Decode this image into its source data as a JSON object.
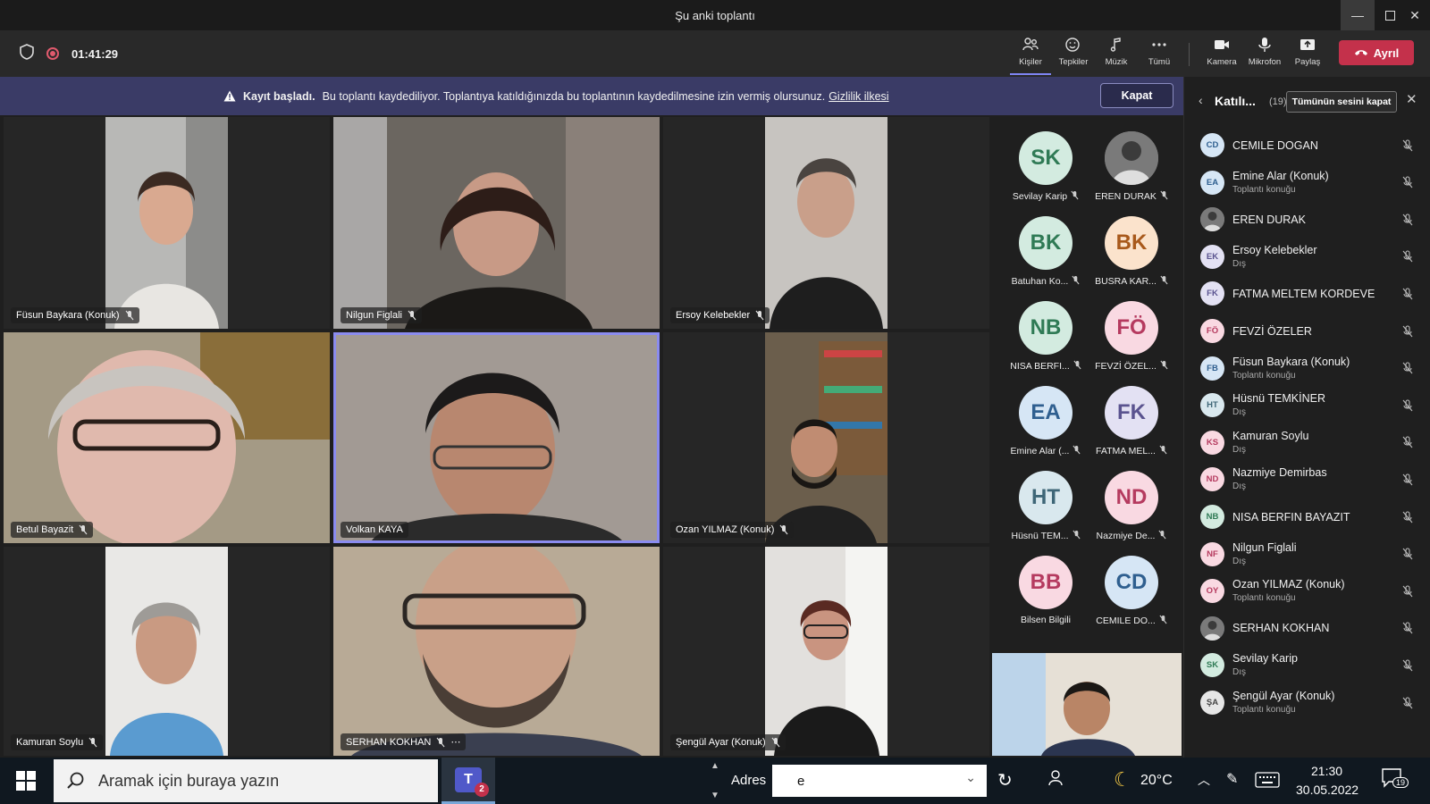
{
  "window": {
    "title": "Şu anki toplantı"
  },
  "toolbar": {
    "timer": "01:41:29",
    "buttons": [
      {
        "label": "Kişiler"
      },
      {
        "label": "Tepkiler"
      },
      {
        "label": "Müzik"
      },
      {
        "label": "Tümü"
      },
      {
        "label": "Kamera"
      },
      {
        "label": "Mikrofon"
      },
      {
        "label": "Paylaş"
      }
    ],
    "leave_label": "Ayrıl"
  },
  "banner": {
    "title": "Kayıt başladı.",
    "message": "Bu toplantı kaydediliyor. Toplantıya katıldığınızda bu toplantının kaydedilmesine izin vermiş olursunuz.",
    "link": "Gizlilik ilkesi",
    "close_label": "Kapat"
  },
  "video_tiles": [
    {
      "name": "Füsun Baykara (Konuk)"
    },
    {
      "name": "Nilgun Figlali"
    },
    {
      "name": "Ersoy Kelebekler"
    },
    {
      "name": "Betul Bayazit"
    },
    {
      "name": "Volkan KAYA"
    },
    {
      "name": "Ozan YILMAZ (Konuk)"
    },
    {
      "name": "Kamuran Soylu"
    },
    {
      "name": "SERHAN KOKHAN"
    },
    {
      "name": "Şengül Ayar (Konuk)"
    }
  ],
  "avatar_grid": [
    {
      "initials": "SK",
      "label": "Sevilay Karip",
      "bg": "#d3ebe0",
      "fg": "#2f7a55"
    },
    {
      "initials": "",
      "label": "EREN DURAK",
      "bg": "#8a8a8a",
      "fg": "#fff"
    },
    {
      "initials": "BK",
      "label": "Batuhan Ko...",
      "bg": "#d3ebe0",
      "fg": "#2f7a55"
    },
    {
      "initials": "BK",
      "label": "BUSRA KAR...",
      "bg": "#fbe3cc",
      "fg": "#a8591b"
    },
    {
      "initials": "NB",
      "label": "NISA BERFI...",
      "bg": "#d3ebe0",
      "fg": "#2f7a55"
    },
    {
      "initials": "FÖ",
      "label": "FEVZİ ÖZEL...",
      "bg": "#f9d9e2",
      "fg": "#b53a5f"
    },
    {
      "initials": "EA",
      "label": "Emine Alar (...",
      "bg": "#d6e6f5",
      "fg": "#2f5f8f"
    },
    {
      "initials": "FK",
      "label": "FATMA MEL...",
      "bg": "#e3e1f3",
      "fg": "#5a538f"
    },
    {
      "initials": "HT",
      "label": "Hüsnü TEM...",
      "bg": "#d9e8ee",
      "fg": "#3e6677"
    },
    {
      "initials": "ND",
      "label": "Nazmiye De...",
      "bg": "#f9d9e2",
      "fg": "#b53a5f"
    },
    {
      "initials": "BB",
      "label": "Bilsen Bilgili",
      "bg": "#f9d9e2",
      "fg": "#b53a5f"
    },
    {
      "initials": "CD",
      "label": "CEMILE DO...",
      "bg": "#d6e6f5",
      "fg": "#2f5f8f"
    }
  ],
  "panel": {
    "title": "Katılı...",
    "count": "(19)",
    "mute_all_label": "Tümünün sesini kapat",
    "participants": [
      {
        "initials": "CD",
        "name": "CEMILE DOGAN",
        "role": "",
        "bg": "#d6e6f5",
        "fg": "#2f5f8f"
      },
      {
        "initials": "EA",
        "name": "Emine Alar (Konuk)",
        "role": "Toplantı konuğu",
        "bg": "#d6e6f5",
        "fg": "#2f5f8f"
      },
      {
        "initials": "",
        "name": "EREN DURAK",
        "role": "",
        "bg": "#8a8a8a",
        "fg": "#fff"
      },
      {
        "initials": "EK",
        "name": "Ersoy Kelebekler",
        "role": "Dış",
        "bg": "#e3e1f3",
        "fg": "#5a538f"
      },
      {
        "initials": "FK",
        "name": "FATMA MELTEM KORDEVE",
        "role": "",
        "bg": "#e3e1f3",
        "fg": "#5a538f"
      },
      {
        "initials": "FÖ",
        "name": "FEVZİ ÖZELER",
        "role": "",
        "bg": "#f9d9e2",
        "fg": "#b53a5f"
      },
      {
        "initials": "FB",
        "name": "Füsun Baykara (Konuk)",
        "role": "Toplantı konuğu",
        "bg": "#d6e6f5",
        "fg": "#2f5f8f"
      },
      {
        "initials": "HT",
        "name": "Hüsnü TEMKİNER",
        "role": "Dış",
        "bg": "#d9e8ee",
        "fg": "#3e6677"
      },
      {
        "initials": "KS",
        "name": "Kamuran Soylu",
        "role": "Dış",
        "bg": "#f9d9e2",
        "fg": "#b53a5f"
      },
      {
        "initials": "ND",
        "name": "Nazmiye Demirbas",
        "role": "Dış",
        "bg": "#f9d9e2",
        "fg": "#b53a5f"
      },
      {
        "initials": "NB",
        "name": "NISA BERFIN BAYAZIT",
        "role": "",
        "bg": "#d3ebe0",
        "fg": "#2f7a55"
      },
      {
        "initials": "NF",
        "name": "Nilgun Figlali",
        "role": "Dış",
        "bg": "#f9d9e2",
        "fg": "#b53a5f"
      },
      {
        "initials": "OY",
        "name": "Ozan YILMAZ (Konuk)",
        "role": "Toplantı konuğu",
        "bg": "#f9d9e2",
        "fg": "#b53a5f"
      },
      {
        "initials": "",
        "name": "SERHAN KOKHAN",
        "role": "",
        "bg": "#5a6a80",
        "fg": "#fff"
      },
      {
        "initials": "SK",
        "name": "Sevilay Karip",
        "role": "Dış",
        "bg": "#d3ebe0",
        "fg": "#2f7a55"
      },
      {
        "initials": "ŞA",
        "name": "Şengül Ayar (Konuk)",
        "role": "Toplantı konuğu",
        "bg": "#e6e6e6",
        "fg": "#444"
      }
    ]
  },
  "taskbar": {
    "search_placeholder": "Aramak için buraya yazın",
    "teams_badge": "2",
    "address_label": "Adres",
    "address_value": "e",
    "temperature": "20°C",
    "time": "21:30",
    "date": "30.05.2022",
    "notifications": "19"
  },
  "colors": {
    "accent": "#7f85f5",
    "leave": "#c4314b",
    "banner": "#3a3b66"
  }
}
